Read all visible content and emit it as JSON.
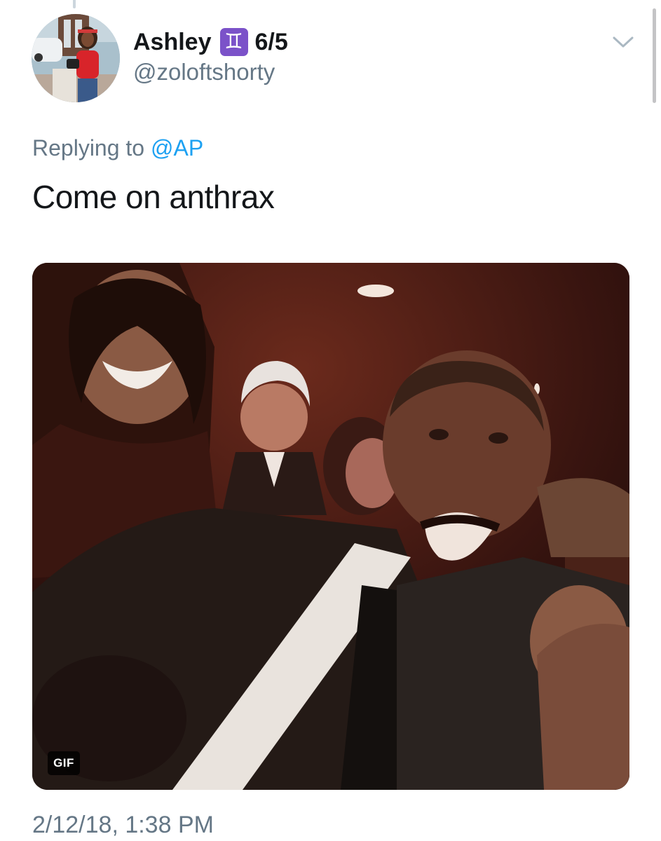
{
  "tweet": {
    "display_name": "Ashley",
    "name_emoji": "♊",
    "name_suffix": "6/5",
    "handle": "@zoloftshorty",
    "reply_prefix": "Replying to",
    "reply_to": "@AP",
    "text": "Come on anthrax",
    "media": {
      "badge": "GIF"
    },
    "timestamp": "2/12/18, 1:38 PM"
  },
  "icons": {
    "menu": "chevron-down-icon",
    "avatar": "profile-photo"
  },
  "colors": {
    "primary_text": "#14171a",
    "secondary_text": "#657786",
    "link": "#1da1f2",
    "emoji_bg": "#7b52c9"
  }
}
